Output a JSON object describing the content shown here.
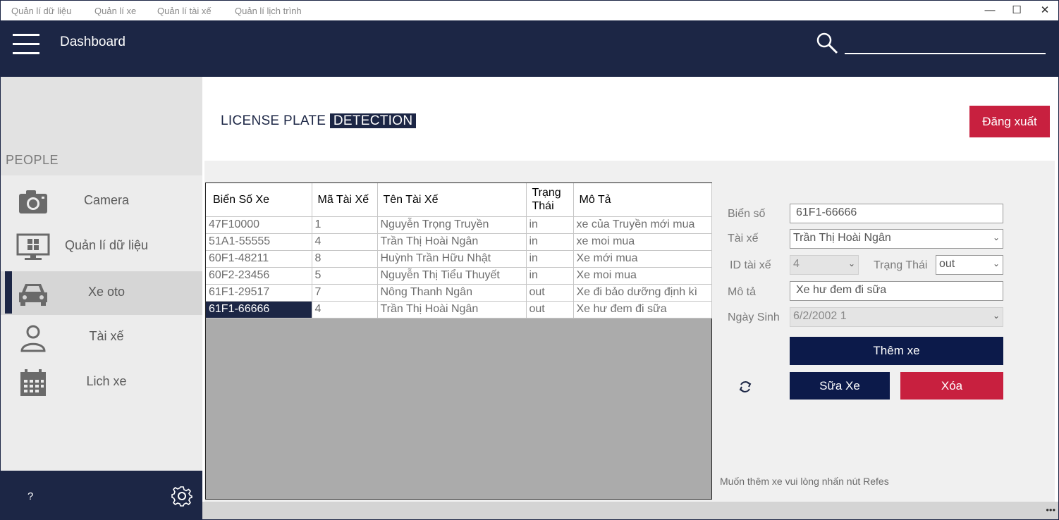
{
  "menu": {
    "items": [
      "Quản lí dữ liệu",
      "Quản lí xe",
      "Quản lí tài xế",
      "Quản lí lịch trình"
    ]
  },
  "window": {
    "minimize": "—",
    "maximize": "☐",
    "close": "✕"
  },
  "header": {
    "title": "Dashboard",
    "search_value": ""
  },
  "sidebar": {
    "section_label": "PEOPLE",
    "items": [
      {
        "label": "Camera",
        "icon": "camera-icon"
      },
      {
        "label": "Quản lí dữ liệu",
        "icon": "monitor-icon"
      },
      {
        "label": "Xe oto",
        "icon": "car-icon",
        "active": true
      },
      {
        "label": "Tài xế",
        "icon": "user-icon"
      },
      {
        "label": "Lich xe",
        "icon": "calendar-icon"
      }
    ],
    "help": "?"
  },
  "brand": {
    "part1": "LICENSE PLATE",
    "part2": "DETECTION"
  },
  "logout_label": "Đăng xuất",
  "grid": {
    "columns": [
      "Biển Số Xe",
      "Mã Tài Xế",
      "Tên Tài Xế",
      "Trạng Thái",
      "Mô Tả"
    ],
    "rows": [
      [
        "47F10000",
        "1",
        "Nguyễn Trọng Truyền",
        "in",
        "xe của Truyền mới mua"
      ],
      [
        "51A1-55555",
        "4",
        "Trần Thị Hoài Ngân",
        "in",
        "xe moi mua"
      ],
      [
        "60F1-48211",
        "8",
        "Huỳnh Trần Hữu Nhật",
        "in",
        "Xe mới mua"
      ],
      [
        "60F2-23456",
        "5",
        "Nguyễn Thị Tiểu Thuyết",
        "in",
        "Xe moi mua"
      ],
      [
        "61F1-29517",
        "7",
        "Nông Thanh Ngân",
        "out",
        "Xe đi bảo dưỡng định kì"
      ],
      [
        "61F1-66666",
        "4",
        "Trần Thị Hoài Ngân",
        "out",
        "Xe hư đem đi sữa"
      ]
    ],
    "selected_row": 5
  },
  "form": {
    "plate_label": "Biển số",
    "plate_value": "61F1-66666",
    "driver_label": "Tài xế",
    "driver_value": "Trần Thị Hoài Ngân",
    "driver_id_label": "ID tài xế",
    "driver_id_value": "4",
    "status_label": "Trạng Thái",
    "status_value": "out",
    "desc_label": "Mô tả",
    "desc_value": "Xe hư đem đi sữa",
    "dob_label": "Ngày Sinh",
    "dob_value": "6/2/2002 1"
  },
  "buttons": {
    "add": "Thêm xe",
    "edit": "Sữa Xe",
    "delete": "Xóa"
  },
  "hint": "Muốn thêm xe vui lòng nhấn nút Refes",
  "colors": {
    "navy": "#1c2645",
    "button_navy": "#0c1a4a",
    "red": "#c8203f"
  }
}
